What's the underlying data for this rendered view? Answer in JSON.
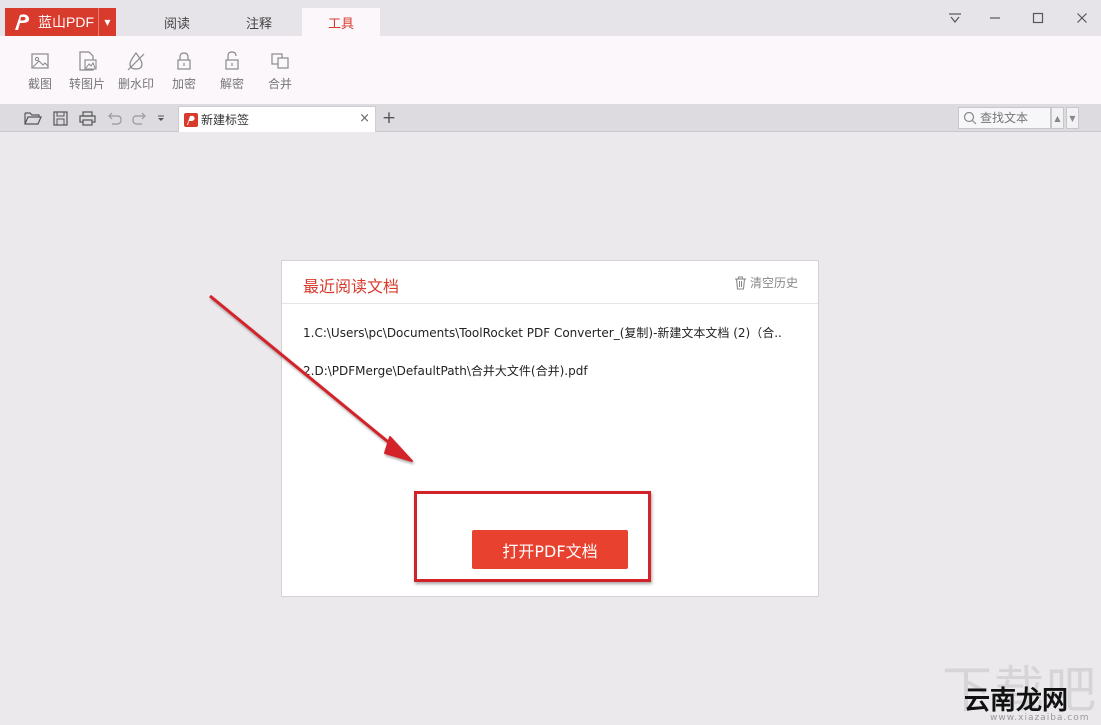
{
  "app": {
    "name": "蓝山PDF",
    "tabs": [
      {
        "label": "阅读",
        "active": false
      },
      {
        "label": "注释",
        "active": false
      },
      {
        "label": "工具",
        "active": true
      }
    ],
    "accent_color": "#d83a2c"
  },
  "window_controls": [
    "menu-icon",
    "minimize-icon",
    "maximize-icon",
    "close-icon"
  ],
  "ribbon": {
    "tools": [
      {
        "label": "截图",
        "icon": "screenshot-icon"
      },
      {
        "label": "转图片",
        "icon": "convert-image-icon"
      },
      {
        "label": "删水印",
        "icon": "remove-watermark-icon"
      },
      {
        "label": "加密",
        "icon": "lock-icon"
      },
      {
        "label": "解密",
        "icon": "unlock-icon"
      },
      {
        "label": "合并",
        "icon": "merge-icon"
      }
    ]
  },
  "quickbar": {
    "icons": [
      "open-folder-icon",
      "save-icon",
      "print-icon",
      "undo-icon",
      "redo-icon",
      "dropdown-icon"
    ]
  },
  "document_tab": {
    "label": "新建标签",
    "close": "×",
    "new_tab": "+"
  },
  "search": {
    "placeholder": "查找文本"
  },
  "recent": {
    "title": "最近阅读文档",
    "clear_label": "清空历史",
    "items": [
      "1.C:\\Users\\pc\\Documents\\ToolRocket PDF Converter_(复制)-新建文本文档 (2)（合...",
      "2.D:\\PDFMerge\\DefaultPath\\合并大文件(合并).pdf"
    ],
    "open_button": "打开PDF文档"
  },
  "watermark": {
    "text": "云南龙网",
    "url": "www.xiazaiba.com"
  }
}
